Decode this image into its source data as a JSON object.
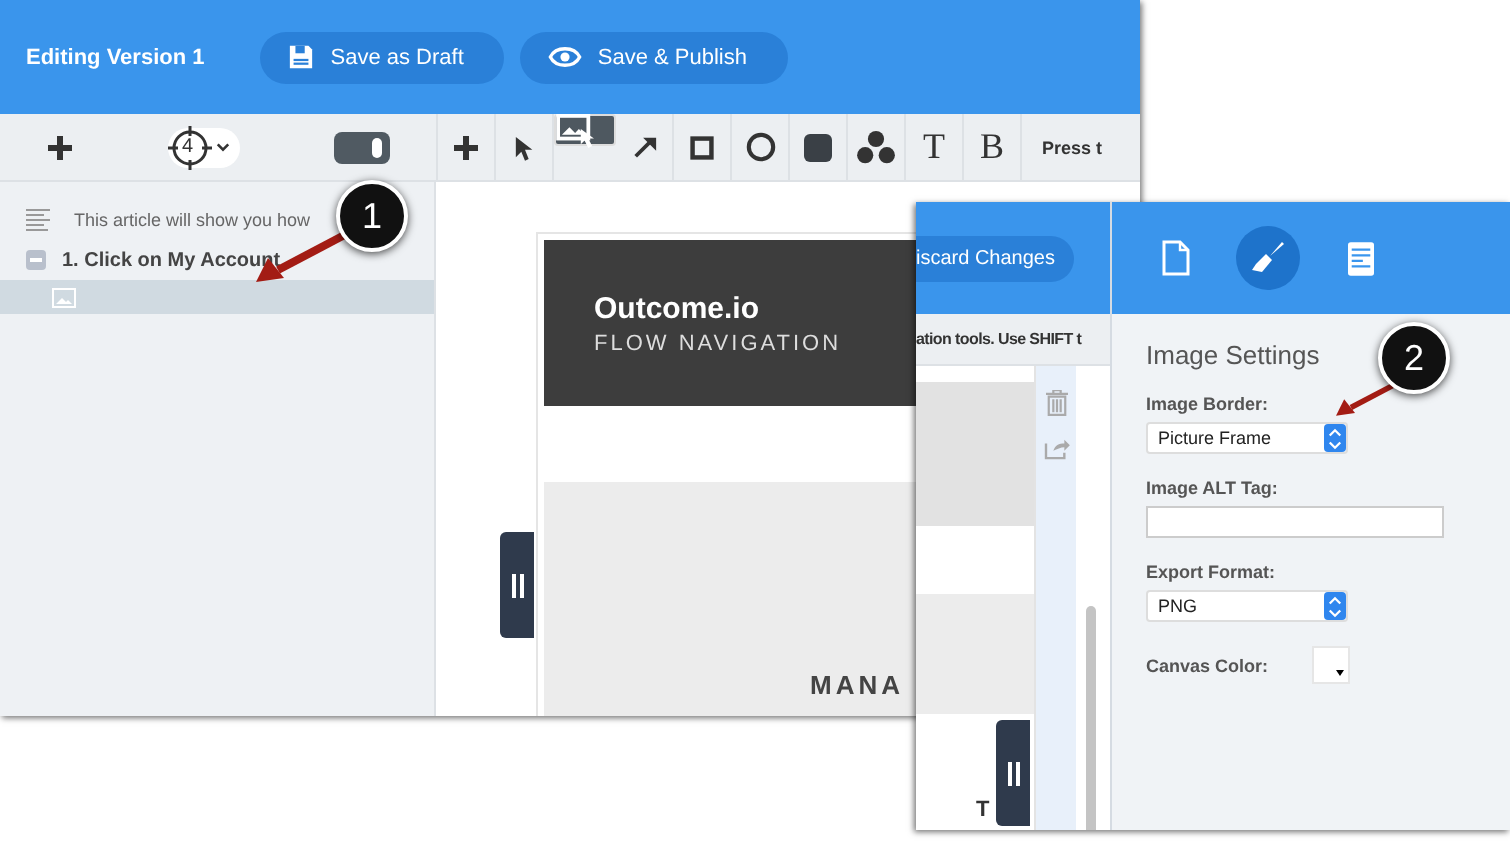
{
  "editor_window": {
    "title": "Editing Version 1",
    "buttons": [
      {
        "label": "Save as Draft"
      },
      {
        "label": "Save & Publish"
      }
    ],
    "target_count": "4",
    "toggle": {
      "on": true
    },
    "tools": [
      {
        "kind": "plus",
        "selected": false
      },
      {
        "kind": "pointer",
        "selected": false
      },
      {
        "kind": "image",
        "selected": true
      },
      {
        "kind": "arrow",
        "selected": false
      },
      {
        "kind": "square",
        "selected": false
      },
      {
        "kind": "circle",
        "selected": false
      },
      {
        "kind": "filled",
        "selected": false
      },
      {
        "kind": "numbers",
        "selected": false
      },
      {
        "kind": "text",
        "label": "T",
        "selected": false
      },
      {
        "kind": "bold",
        "label": "B",
        "selected": false
      }
    ],
    "hint": "Press t",
    "outline": [
      {
        "kind": "text",
        "label": "This article will show you how"
      },
      {
        "kind": "step",
        "label": "1.  Click on My Account",
        "expanded": true,
        "children": [
          {
            "kind": "image",
            "selected": true
          }
        ]
      }
    ],
    "page": {
      "brand": "Outcome.io",
      "subtitle": "FLOW NAVIGATION",
      "menu_text": "MANA"
    }
  },
  "settings_window": {
    "discard_button": "iscard Changes",
    "hint": "ation tools. Use SHIFT t",
    "canvas_letter": "T",
    "tabs": [
      {
        "kind": "page",
        "selected": false
      },
      {
        "kind": "brush",
        "selected": true
      },
      {
        "kind": "list",
        "selected": false
      }
    ],
    "title": "Image Settings",
    "fields": [
      {
        "kind": "select",
        "label": "Image Border:",
        "value": "Picture Frame"
      },
      {
        "kind": "text",
        "label": "Image ALT Tag:"
      },
      {
        "kind": "select",
        "label": "Export Format:",
        "value": "PNG"
      },
      {
        "kind": "color",
        "label": "Canvas Color:"
      }
    ]
  },
  "callouts": [
    "1",
    "2"
  ]
}
